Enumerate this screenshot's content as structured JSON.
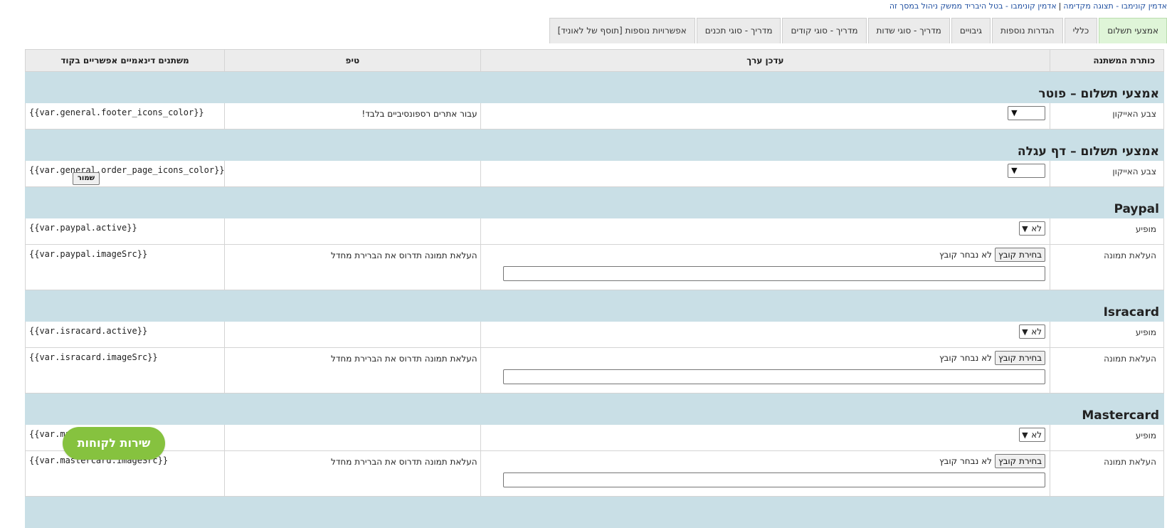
{
  "breadcrumb": {
    "prefix": "אדמין קונימבו - תצוגה מקדימה",
    "separator": "|",
    "link": "אדמין קונימבו - בטל היבריד ממשק ניהול במסך זה"
  },
  "tabs": [
    {
      "label": "אמצעי תשלום",
      "active": true
    },
    {
      "label": "כללי"
    },
    {
      "label": "הגדרות נוספות"
    },
    {
      "label": "גיבויים"
    },
    {
      "label": "מדריך - סוגי שדות"
    },
    {
      "label": "מדריך - סוגי קודים"
    },
    {
      "label": "מדריך - סוגי תכנים"
    },
    {
      "label": "אפשרויות נוספות [תוסף של לאוניד]"
    }
  ],
  "columns": {
    "title": "כותרת המשתנה",
    "value": "עדכן ערך",
    "tip": "טיפ",
    "var": "משתנים דינאמיים אפשריים בקוד"
  },
  "sections": [
    {
      "heading": "אמצעי תשלום – פוטר",
      "rows": [
        {
          "kind": "color",
          "label": "צבע האייקון",
          "tip": "עבור אתרים רספונסיביים בלבד!",
          "var": "{{var.general.footer_icons_color}}"
        }
      ]
    },
    {
      "heading": "אמצעי תשלום – דף עגלה",
      "rows": [
        {
          "kind": "color",
          "label": "צבע האייקון",
          "tip": "",
          "var": "{{var.general.order_page_icons_color}}"
        }
      ]
    },
    {
      "heading": "Paypal",
      "rows": [
        {
          "kind": "yn",
          "label": "מופיע",
          "value": "לא",
          "tip": "",
          "var": "{{var.paypal.active}}"
        },
        {
          "kind": "file",
          "label": "העלאת תמונה",
          "tip": "העלאת תמונה תדרוס את הברירת מחדל",
          "var": "{{var.paypal.imageSrc}}"
        }
      ]
    },
    {
      "heading": "Isracard",
      "rows": [
        {
          "kind": "yn",
          "label": "מופיע",
          "value": "לא",
          "tip": "",
          "var": "{{var.isracard.active}}"
        },
        {
          "kind": "file",
          "label": "העלאת תמונה",
          "tip": "העלאת תמונה תדרוס את הברירת מחדל",
          "var": "{{var.isracard.imageSrc}}"
        }
      ]
    },
    {
      "heading": "Mastercard",
      "rows": [
        {
          "kind": "yn",
          "label": "מופיע",
          "value": "לא",
          "tip": "",
          "var": "{{var.mastercard.active}}"
        },
        {
          "kind": "file",
          "label": "העלאת תמונה",
          "tip": "העלאת תמונה תדרוס את הברירת מחדל",
          "var": "{{var.mastercard.imageSrc}}"
        }
      ]
    }
  ],
  "file": {
    "button_label": "בחירת קובץ",
    "none_label": "לא נבחר קובץ"
  },
  "save_label": "שמור",
  "support_label": "שירות לקוחות",
  "colors": {
    "section_bg": "#c9dfe6",
    "tab_active_bg": "#dff5d8",
    "support_bg": "#86c23f"
  }
}
